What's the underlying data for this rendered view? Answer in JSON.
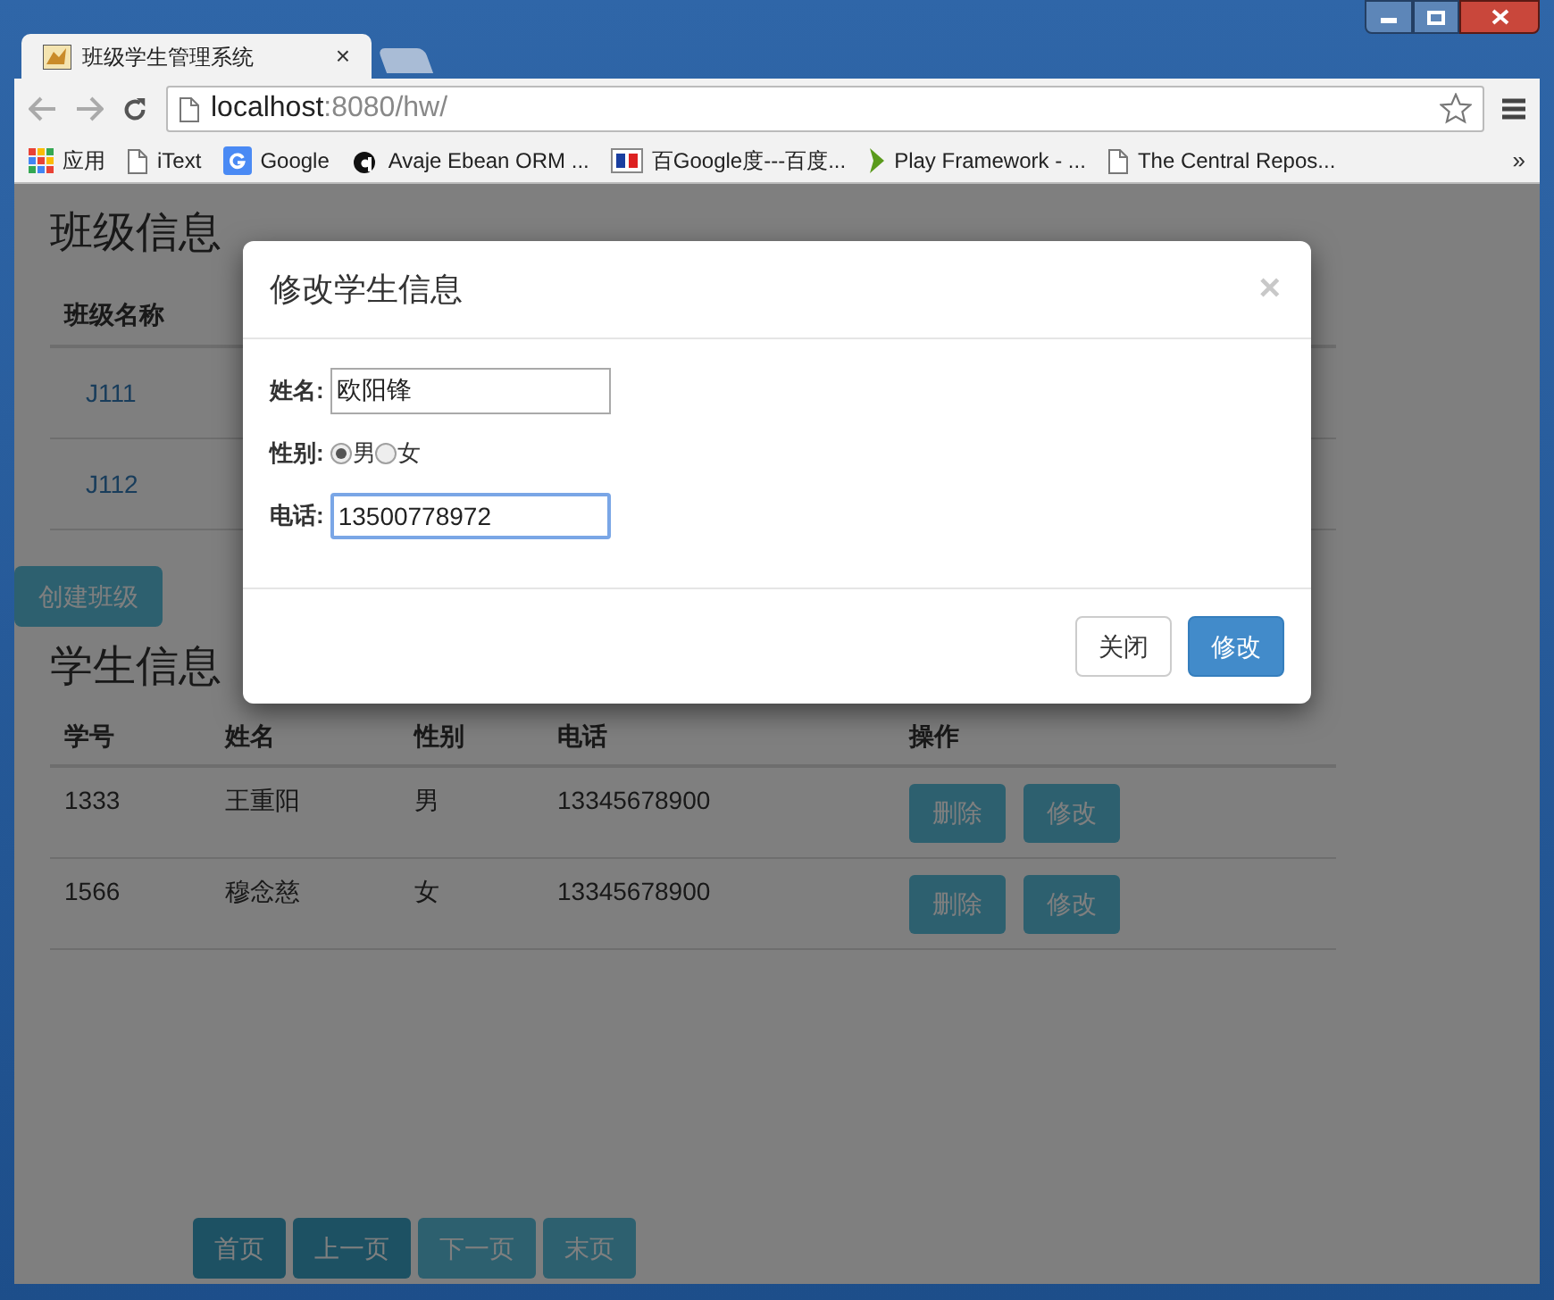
{
  "browser": {
    "tabs": [
      {
        "title": "班级学生管理系统",
        "close": "×",
        "selected": true
      },
      {
        "selected": false
      }
    ],
    "address": {
      "host": "localhost",
      "rest": ":8080/hw/"
    },
    "bookmarks": [
      {
        "kind": "apps",
        "label": "应用"
      },
      {
        "kind": "page",
        "label": "iText"
      },
      {
        "kind": "google",
        "label": "Google"
      },
      {
        "kind": "avaje",
        "label": "Avaje Ebean ORM ..."
      },
      {
        "kind": "bg",
        "label": "百Google度---百度..."
      },
      {
        "kind": "play",
        "label": "Play Framework - ..."
      },
      {
        "kind": "page",
        "label": "The Central Repos..."
      }
    ],
    "overflow": "»"
  },
  "class_section": {
    "heading": "班级信息",
    "columns": [
      "班级名称"
    ],
    "rows": [
      "J111",
      "J112"
    ],
    "create_button": "创建班级"
  },
  "student_section": {
    "heading": "学生信息",
    "columns": [
      "学号",
      "姓名",
      "性别",
      "电话",
      "操作"
    ],
    "rows": [
      {
        "id": "1333",
        "name": "王重阳",
        "gender": "男",
        "phone": "13345678900",
        "actions": [
          "删除",
          "修改"
        ]
      },
      {
        "id": "1566",
        "name": "穆念慈",
        "gender": "女",
        "phone": "13345678900",
        "actions": [
          "删除",
          "修改"
        ]
      }
    ]
  },
  "pagination": [
    {
      "label": "首页",
      "disabled": false
    },
    {
      "label": "上一页",
      "disabled": false
    },
    {
      "label": "下一页",
      "disabled": true
    },
    {
      "label": "末页",
      "disabled": true
    }
  ],
  "modal": {
    "title": "修改学生信息",
    "close": "×",
    "fields": [
      {
        "kind": "text",
        "label": "姓名:",
        "value": "欧阳锋",
        "focused": false
      },
      {
        "kind": "radio",
        "label": "性别:",
        "options": [
          {
            "label": "男",
            "selected": true
          },
          {
            "label": "女",
            "selected": false
          }
        ]
      },
      {
        "kind": "text",
        "label": "电话:",
        "value": "13500778972",
        "focused": true
      }
    ],
    "buttons": [
      {
        "label": "关闭",
        "kind": "default"
      },
      {
        "label": "修改",
        "kind": "primary"
      }
    ]
  }
}
